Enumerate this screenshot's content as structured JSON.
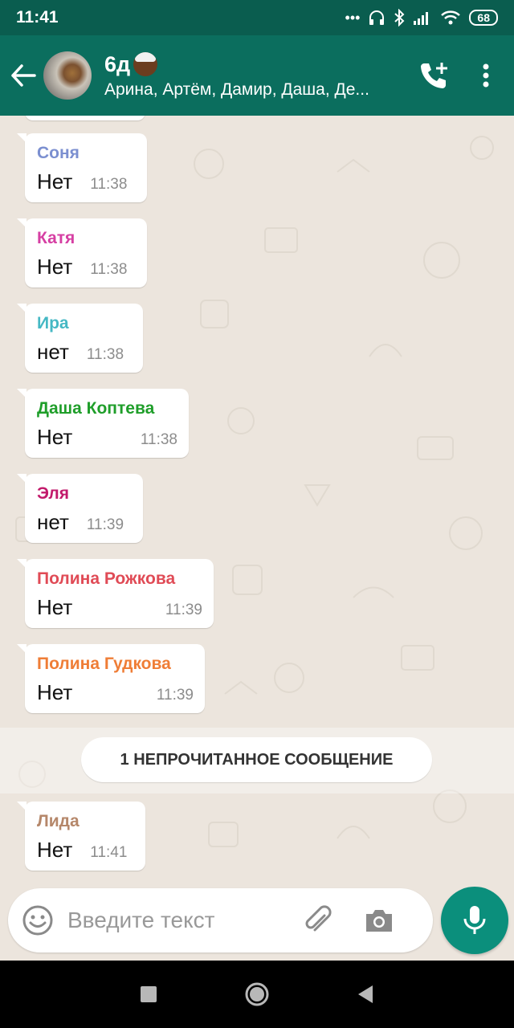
{
  "status_bar": {
    "time": "11:41",
    "dots": "•••",
    "battery": "68"
  },
  "header": {
    "title": "6д",
    "subtitle": "Арина, Артём, Дамир, Даша, Де..."
  },
  "messages": [
    {
      "sender": "Соня",
      "color": "#7b8fd0",
      "text": "Нет",
      "time": "11:38"
    },
    {
      "sender": "Катя",
      "color": "#d63fa3",
      "text": "Нет",
      "time": "11:38"
    },
    {
      "sender": "Ира",
      "color": "#45b8c4",
      "text": "нет",
      "time": "11:38"
    },
    {
      "sender": "Даша Коптева",
      "color": "#1f9e2a",
      "text": "Нет",
      "time": "11:38"
    },
    {
      "sender": "Эля",
      "color": "#c21a6b",
      "text": "нет",
      "time": "11:39"
    },
    {
      "sender": "Полина Рожкова",
      "color": "#e04b56",
      "text": "Нет",
      "time": "11:39"
    },
    {
      "sender": "Полина Гудкова",
      "color": "#ef7d36",
      "text": "Нет",
      "time": "11:39"
    },
    {
      "sender": "Лида",
      "color": "#b5876a",
      "text": "Нет",
      "time": "11:41"
    }
  ],
  "unread_banner": "1 НЕПРОЧИТАННОЕ СООБЩЕНИЕ",
  "composer": {
    "placeholder": "Введите текст"
  },
  "colors": {
    "header": "#0b6e5e",
    "status_bar": "#0a5d4f",
    "accent": "#0b8f7c",
    "chat_bg": "#ece5dd"
  },
  "icons": [
    "back-arrow-icon",
    "add-call-icon",
    "more-vert-icon",
    "emoji-icon",
    "attach-icon",
    "camera-icon",
    "mic-icon",
    "nav-recents-icon",
    "nav-home-icon",
    "nav-back-icon"
  ]
}
